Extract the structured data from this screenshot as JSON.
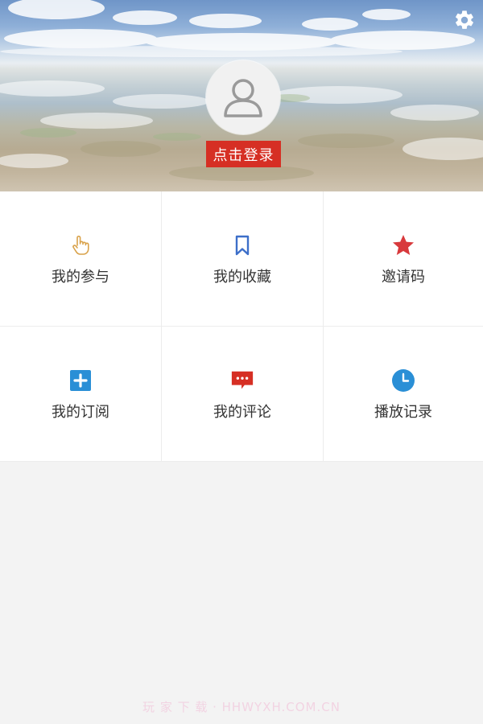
{
  "header": {
    "login_label": "点击登录",
    "settings_icon": "gear-icon",
    "avatar_icon": "user-icon"
  },
  "menu": [
    {
      "label": "我的参与",
      "icon": "hand-pointer-icon",
      "color": "#d9a24a"
    },
    {
      "label": "我的收藏",
      "icon": "bookmark-icon",
      "color": "#3d6fc9"
    },
    {
      "label": "邀请码",
      "icon": "star-icon",
      "color": "#d8393c"
    },
    {
      "label": "我的订阅",
      "icon": "plus-square-icon",
      "color": "#2a8fd6"
    },
    {
      "label": "我的评论",
      "icon": "comment-icon",
      "color": "#d62f24"
    },
    {
      "label": "播放记录",
      "icon": "clock-icon",
      "color": "#2a8fd6"
    }
  ],
  "watermark": "玩 家 下 载 · HHWYXH.COM.CN"
}
